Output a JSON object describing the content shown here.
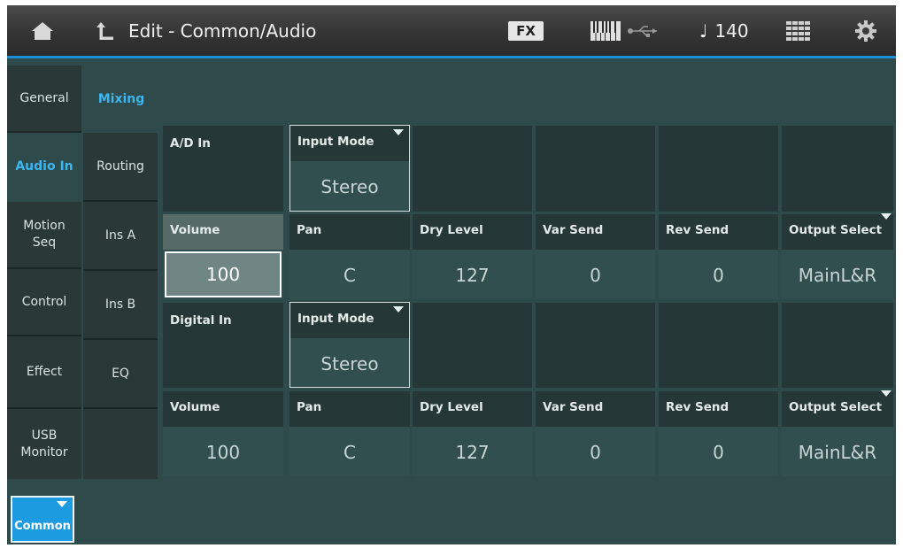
{
  "topbar": {
    "home_icon": "home-icon",
    "back_icon": "back-arrow-icon",
    "title": "Edit - Common/Audio",
    "fx_label": "FX",
    "tempo_note": "♩",
    "tempo": "140"
  },
  "nav": {
    "level1": [
      "General",
      "Audio In",
      "Motion\nSeq",
      "Control",
      "Effect",
      "USB\nMonitor"
    ],
    "level2": [
      "Routing",
      "Ins A",
      "Ins B",
      "EQ"
    ],
    "mixing": "Mixing"
  },
  "ad_in": {
    "label": "A/D In",
    "input_mode_label": "Input Mode",
    "input_mode_value": "Stereo",
    "params": [
      {
        "label": "Volume",
        "value": "100"
      },
      {
        "label": "Pan",
        "value": "C"
      },
      {
        "label": "Dry Level",
        "value": "127"
      },
      {
        "label": "Var Send",
        "value": "0"
      },
      {
        "label": "Rev Send",
        "value": "0"
      },
      {
        "label": "Output Select",
        "value": "MainL&R"
      }
    ]
  },
  "digital_in": {
    "label": "Digital In",
    "input_mode_label": "Input Mode",
    "input_mode_value": "Stereo",
    "params": [
      {
        "label": "Volume",
        "value": "100"
      },
      {
        "label": "Pan",
        "value": "C"
      },
      {
        "label": "Dry Level",
        "value": "127"
      },
      {
        "label": "Var Send",
        "value": "0"
      },
      {
        "label": "Rev Send",
        "value": "0"
      },
      {
        "label": "Output Select",
        "value": "MainL&R"
      }
    ]
  },
  "bottom": {
    "common_label": "Common"
  },
  "colors": {
    "accent": "#1e8fd6",
    "active_text": "#3cb6f0",
    "background": "#2e4a4a"
  }
}
